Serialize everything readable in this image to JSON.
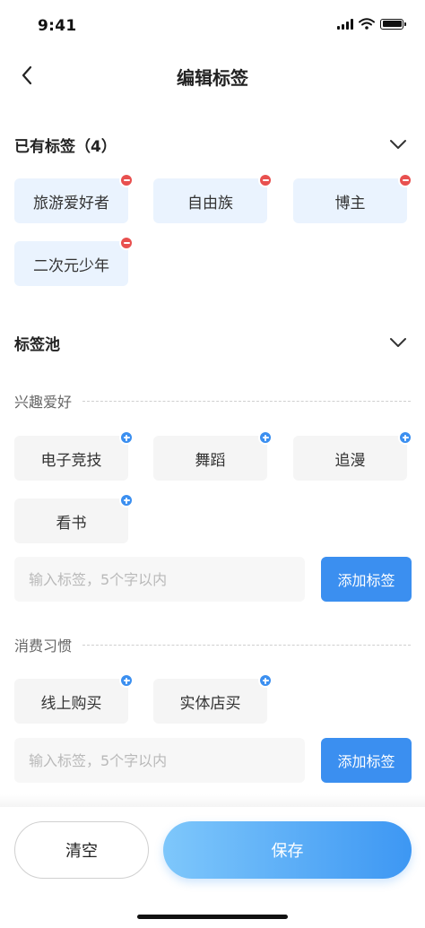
{
  "status_bar": {
    "time": "9:41"
  },
  "nav": {
    "title": "编辑标签"
  },
  "owned": {
    "title": "已有标签（4）",
    "tags": [
      {
        "label": "旅游爱好者"
      },
      {
        "label": "自由族"
      },
      {
        "label": "博主"
      },
      {
        "label": "二次元少年"
      }
    ]
  },
  "pool": {
    "title": "标签池",
    "groups": [
      {
        "title": "兴趣爱好",
        "tags": [
          {
            "label": "电子竞技"
          },
          {
            "label": "舞蹈"
          },
          {
            "label": "追漫"
          },
          {
            "label": "看书"
          }
        ],
        "input_placeholder": "输入标签，5个字以内",
        "add_label": "添加标签"
      },
      {
        "title": "消费习惯",
        "tags": [
          {
            "label": "线上购买"
          },
          {
            "label": "实体店买"
          }
        ],
        "input_placeholder": "输入标签，5个字以内",
        "add_label": "添加标签"
      }
    ]
  },
  "footer": {
    "clear_label": "清空",
    "save_label": "保存"
  },
  "colors": {
    "accent": "#3b8ff0",
    "remove": "#e8504f",
    "owned_tag_bg": "#eaf3fe",
    "pool_tag_bg": "#f5f5f5"
  }
}
